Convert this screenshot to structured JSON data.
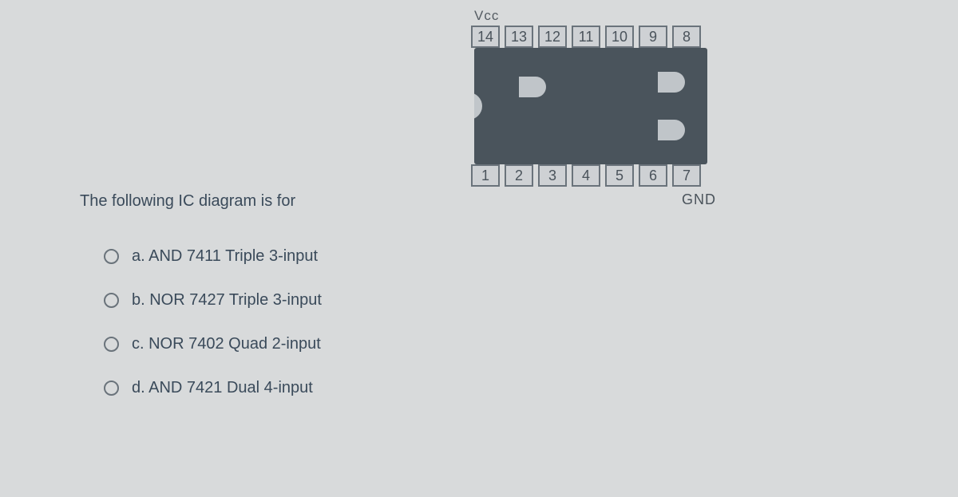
{
  "ic": {
    "vcc": "Vcc",
    "gnd": "GND",
    "top_pins": [
      "14",
      "13",
      "12",
      "11",
      "10",
      "9",
      "8"
    ],
    "bottom_pins": [
      "1",
      "2",
      "3",
      "4",
      "5",
      "6",
      "7"
    ]
  },
  "question": "The following IC diagram is for",
  "options": [
    {
      "id": "a",
      "label": "a. AND 7411 Triple 3-input"
    },
    {
      "id": "b",
      "label": "b. NOR 7427 Triple 3-input"
    },
    {
      "id": "c",
      "label": "c. NOR 7402 Quad 2-input"
    },
    {
      "id": "d",
      "label": "d. AND 7421 Dual 4-input"
    }
  ]
}
